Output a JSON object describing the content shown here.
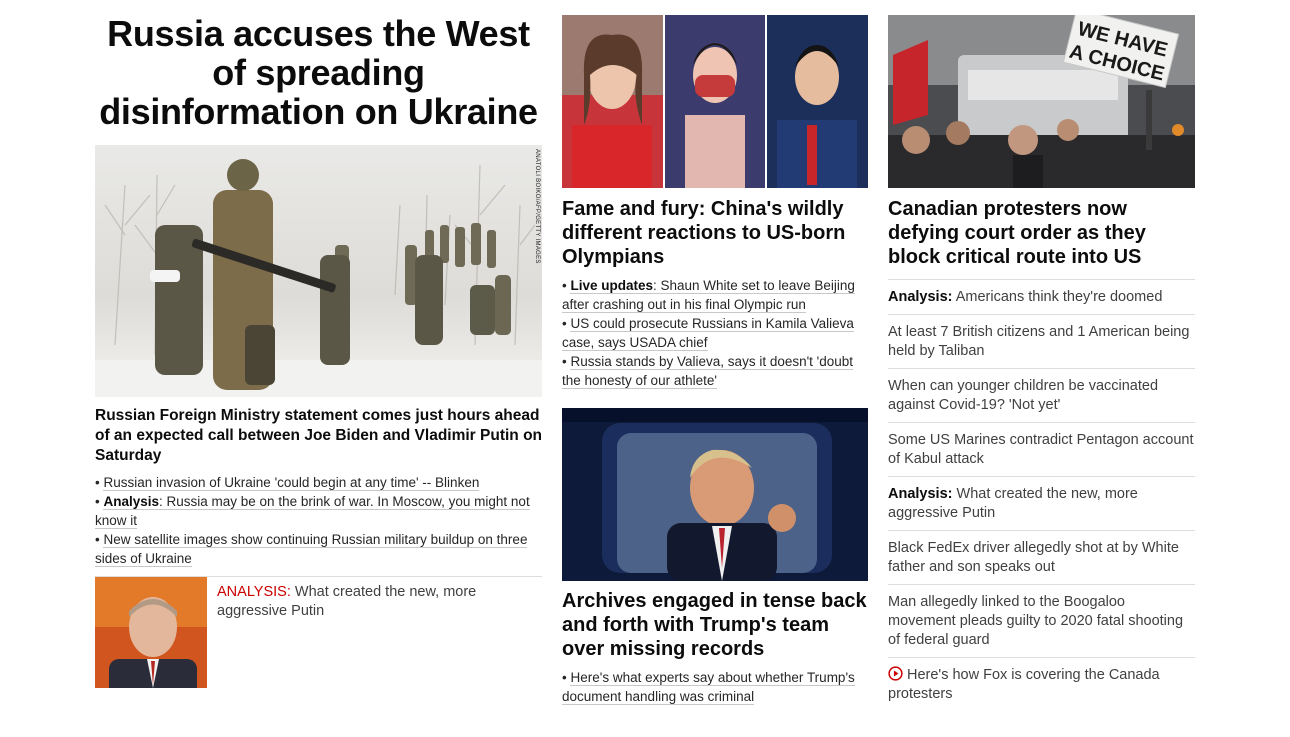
{
  "lead": {
    "headline": "Russia accuses the West of spreading disinformation on Ukraine",
    "photo_credit": "ANATOLI BOIKO/AFP/GETTY IMAGES",
    "subheadline": "Russian Foreign Ministry statement comes just hours ahead of an expected call between Joe Biden and Vladimir Putin on Saturday",
    "bullets": [
      {
        "prefix": "",
        "text": "Russian invasion of Ukraine 'could begin at any time' -- Blinken"
      },
      {
        "prefix": "Analysis",
        "text": ": Russia may be on the brink of war. In Moscow, you might not know it"
      },
      {
        "prefix": "",
        "text": "New satellite images show continuing Russian military buildup on three sides of Ukraine"
      }
    ],
    "mini": {
      "kicker": "ANALYSIS:",
      "text": "What created the new, more aggressive Putin"
    }
  },
  "olympics": {
    "headline": "Fame and fury: China's wildly different reactions to US-born Olympians",
    "bullets": [
      {
        "prefix": "Live updates",
        "text": ": Shaun White set to leave Beijing after crashing out in his final Olympic run"
      },
      {
        "prefix": "",
        "text": "US could prosecute Russians in Kamila Valieva case, says USADA chief"
      },
      {
        "prefix": "",
        "text": "Russia stands by Valieva, says it doesn't 'doubt the honesty of our athlete'"
      }
    ]
  },
  "trump": {
    "headline": "Archives engaged in tense back and forth with Trump's team over missing records",
    "bullets": [
      {
        "prefix": "",
        "text": "Here's what experts say about whether Trump's document handling was criminal"
      }
    ]
  },
  "canada": {
    "sign_text_1": "WE HAVE",
    "sign_text_2": "A CHOICE",
    "headline": "Canadian protesters now defying court order as they block critical route into US",
    "list": [
      {
        "prefix": "Analysis:",
        "text": " Americans think they're doomed"
      },
      {
        "prefix": "",
        "text": "At least 7 British citizens and 1 American being held by Taliban"
      },
      {
        "prefix": "",
        "text": "When can younger children be vaccinated against Covid-19? 'Not yet'"
      },
      {
        "prefix": "",
        "text": "Some US Marines contradict Pentagon account of Kabul attack"
      },
      {
        "prefix": "Analysis:",
        "text": " What created the new, more aggressive Putin"
      },
      {
        "prefix": "",
        "text": "Black FedEx driver allegedly shot at by White father and son speaks out"
      },
      {
        "prefix": "",
        "text": "Man allegedly linked to the Boogaloo movement pleads guilty to 2020 fatal shooting of federal guard"
      }
    ],
    "video_item": {
      "icon": "play-circle-icon",
      "text": "Here's how Fox is covering the Canada protesters"
    }
  },
  "colors": {
    "accent": "#cc0000",
    "text": "#0c0c0c",
    "muted": "#404040",
    "rule": "#dddddd"
  }
}
